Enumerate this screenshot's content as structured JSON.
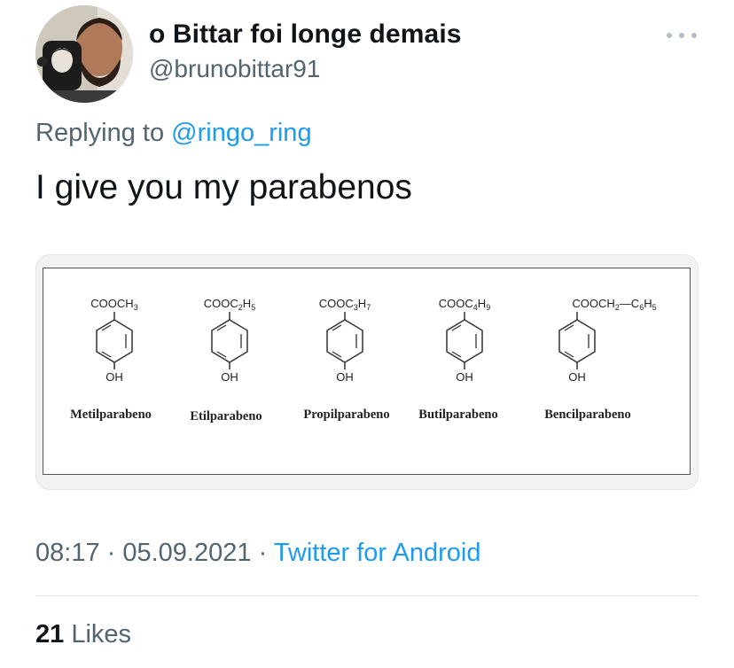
{
  "author": {
    "display_name": "o Bittar foi longe demais",
    "handle": "@brunobittar91"
  },
  "reply": {
    "prefix": "Replying to",
    "mention": "@ringo_ring"
  },
  "tweet": {
    "text": "I give you my parabenos"
  },
  "figure": {
    "compounds": [
      {
        "name": "Metilparabeno",
        "substituent": "COOCH",
        "sub": "3",
        "hydroxyl": "OH"
      },
      {
        "name": "Etilparabeno",
        "substituent": "COOC",
        "sub": "2",
        "sub_tail": "H",
        "sub2": "5",
        "hydroxyl": "OH"
      },
      {
        "name": "Propilparabeno",
        "substituent": "COOC",
        "sub": "3",
        "sub_tail": "H",
        "sub2": "7",
        "hydroxyl": "OH"
      },
      {
        "name": "Butilparabeno",
        "substituent": "COOC",
        "sub": "4",
        "sub_tail": "H",
        "sub2": "9",
        "hydroxyl": "OH"
      },
      {
        "name": "Bencilparabeno",
        "substituent": "COOCH",
        "sub": "2",
        "sub_tail": "—C",
        "sub2": "6",
        "sub_tail2": "H",
        "sub3": "5",
        "hydroxyl": "OH"
      }
    ]
  },
  "meta": {
    "time": "08:17",
    "separator": " · ",
    "date": "05.09.2021",
    "source": "Twitter for Android"
  },
  "stats": {
    "likes_count": "21",
    "likes_label": " Likes"
  },
  "icons": {
    "more": "more-dots-icon"
  },
  "colors": {
    "link": "#1d9bf0",
    "secondary_text": "#536471",
    "primary_text": "#0f1419"
  }
}
